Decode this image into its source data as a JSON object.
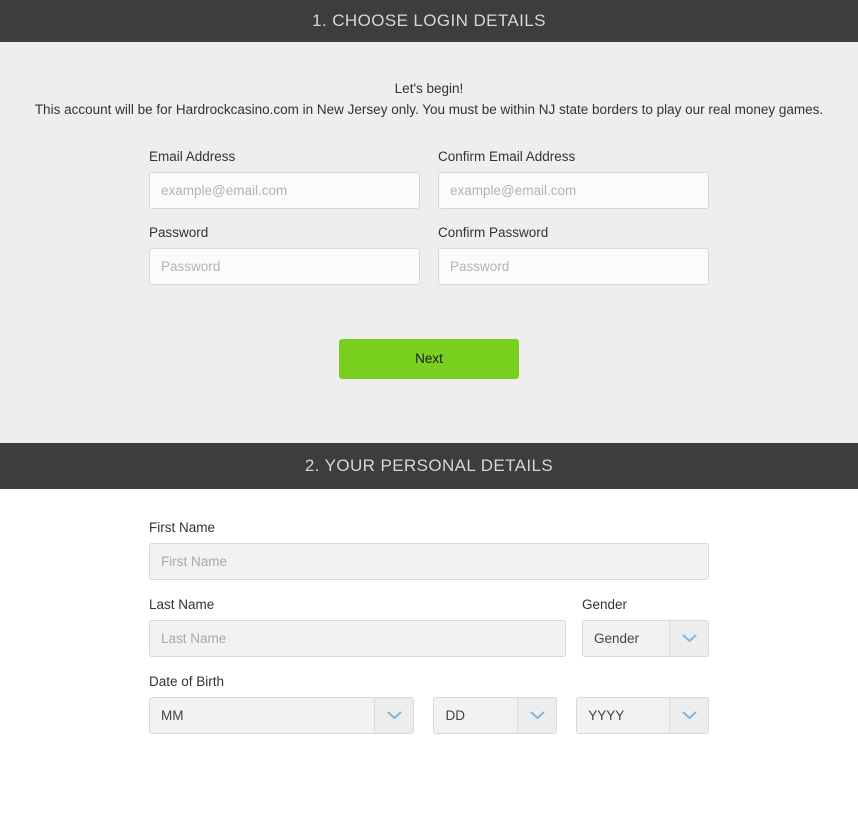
{
  "sections": [
    {
      "bar_title": "1. CHOOSE LOGIN DETAILS",
      "intro": {
        "line1": "Let's begin!",
        "line2": "This account will be for Hardrockcasino.com in New Jersey only. You must be within NJ state borders to play our real money games."
      },
      "fields": {
        "email": {
          "label": "Email Address",
          "value": "",
          "placeholder": "example@email.com"
        },
        "confirm_email": {
          "label": "Confirm Email Address",
          "value": "",
          "placeholder": "example@email.com"
        },
        "password": {
          "label": "Password",
          "value": "",
          "placeholder": "Password"
        },
        "confirm_password": {
          "label": "Confirm Password",
          "value": "",
          "placeholder": "Password"
        }
      },
      "next_button": "Next"
    },
    {
      "bar_title": "2. YOUR PERSONAL DETAILS",
      "fields": {
        "first_name": {
          "label": "First Name",
          "value": "",
          "placeholder": "First Name"
        },
        "last_name": {
          "label": "Last Name",
          "value": "",
          "placeholder": "Last Name"
        },
        "gender": {
          "label": "Gender",
          "selected": "Gender"
        },
        "date_of_birth": {
          "label": "Date of Birth",
          "month_selected": "MM",
          "day_selected": "DD",
          "year_selected": "YYYY"
        }
      }
    }
  ],
  "icons": {
    "chevron_down": "chevron-down-icon"
  },
  "colors": {
    "bar_background": "#3d3d3d",
    "bar_text": "#d8d6d3",
    "section1_background": "#eeeeee",
    "accent_green": "#7ad01f",
    "chevron_blue": "#7fb6dd",
    "label_text": "#333333",
    "placeholder_text": "#b3b3b3"
  }
}
